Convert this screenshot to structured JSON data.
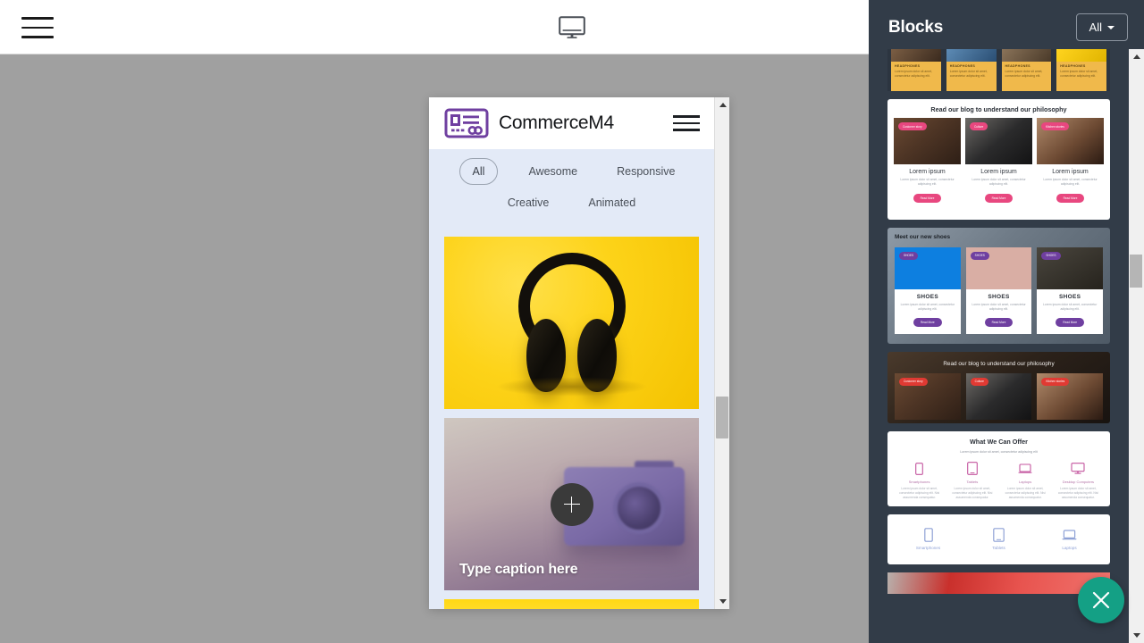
{
  "toolbar": {
    "menu_icon": "hamburger-icon",
    "device_icon": "desktop-monitor-icon"
  },
  "preview": {
    "site": {
      "brand": "CommerceM4",
      "logo_icon": "card-logo-icon",
      "menu_icon": "hamburger-icon"
    },
    "filters": {
      "row1": [
        "All",
        "Awesome",
        "Responsive"
      ],
      "row2": [
        "Creative",
        "Animated"
      ],
      "active": "All"
    },
    "gallery": [
      {
        "id": "item-headphones",
        "caption": ""
      },
      {
        "id": "item-camera",
        "caption": "Type caption here",
        "add_icon": "plus-icon"
      }
    ]
  },
  "sidebar": {
    "title": "Blocks",
    "filter_label": "All",
    "filter_icon": "chevron-down-icon",
    "close_icon": "close-x-icon",
    "blocks": [
      {
        "id": "headphones",
        "cards": [
          {
            "title": "HEADPHONES",
            "text": "Lorem ipsum dolor sit amet, consectetur adipiscing elit."
          },
          {
            "title": "HEADPHONES",
            "text": "Lorem ipsum dolor sit amet, consectetur adipiscing elit."
          },
          {
            "title": "HEADPHONES",
            "text": "Lorem ipsum dolor sit amet, consectetur adipiscing elit."
          },
          {
            "title": "HEADPHONES",
            "text": "Lorem ipsum dolor sit amet, consectetur adipiscing elit."
          }
        ]
      },
      {
        "id": "blog-light",
        "title": "Read our blog to understand our philosophy",
        "accent": "#e8477f",
        "cards": [
          {
            "badge": "Customer story",
            "heading": "Lorem ipsum",
            "text": "Lorem ipsum dolor sit amet, consectetur adipiscing elit.",
            "button": "Read More"
          },
          {
            "badge": "Culture",
            "heading": "Lorem ipsum",
            "text": "Lorem ipsum dolor sit amet, consectetur adipiscing elit.",
            "button": "Read More"
          },
          {
            "badge": "Kitchen stories",
            "heading": "Lorem ipsum",
            "text": "Lorem ipsum dolor sit amet, consectetur adipiscing elit.",
            "button": "Read More"
          }
        ]
      },
      {
        "id": "shoes",
        "title": "Meet our new shoes",
        "accent": "#6f3fa0",
        "cards": [
          {
            "badge": "SHOES",
            "heading": "SHOES",
            "text": "Lorem ipsum dolor sit amet, consectetur adipiscing elit.",
            "button": "Read More"
          },
          {
            "badge": "SHOES",
            "heading": "SHOES",
            "text": "Lorem ipsum dolor sit amet, consectetur adipiscing elit.",
            "button": "Read More"
          },
          {
            "badge": "SHOES",
            "heading": "SHOES",
            "text": "Lorem ipsum dolor sit amet, consectetur adipiscing elit.",
            "button": "Read More"
          }
        ]
      },
      {
        "id": "blog-dark",
        "title": "Read our blog to understand our philosophy",
        "accent": "#e03a33",
        "cards": [
          {
            "badge": "Customer story"
          },
          {
            "badge": "Culture"
          },
          {
            "badge": "Kitchen stories"
          }
        ]
      },
      {
        "id": "offer",
        "title": "What We Can Offer",
        "subtitle": "Lorem ipsum dolor sit amet, consectetur adipiscing elit",
        "accent": "#c4569f",
        "items": [
          {
            "icon": "smartphone-icon",
            "label": "Smartphones",
            "text": "Lorem ipsum dolor sit amet, consectetur adipiscing elit. Nisi assumenda consequatur."
          },
          {
            "icon": "tablet-icon",
            "label": "Tablets",
            "text": "Lorem ipsum dolor sit amet, consectetur adipiscing elit. Nisi assumenda consequatur."
          },
          {
            "icon": "laptop-icon",
            "label": "Laptops",
            "text": "Lorem ipsum dolor sit amet, consectetur adipiscing elit. Nisi assumenda consequatur."
          },
          {
            "icon": "desktop-icon",
            "label": "Desktop Computers",
            "text": "Lorem ipsum dolor sit amet, consectetur adipiscing elit. Nisi assumenda consequatur."
          }
        ]
      },
      {
        "id": "offer2",
        "accent": "#8fa2d6",
        "items": [
          {
            "icon": "smartphone-icon",
            "label": "Smartphones"
          },
          {
            "icon": "tablet-icon",
            "label": "Tablets"
          },
          {
            "icon": "laptop-icon",
            "label": "Laptops"
          }
        ]
      }
    ]
  }
}
